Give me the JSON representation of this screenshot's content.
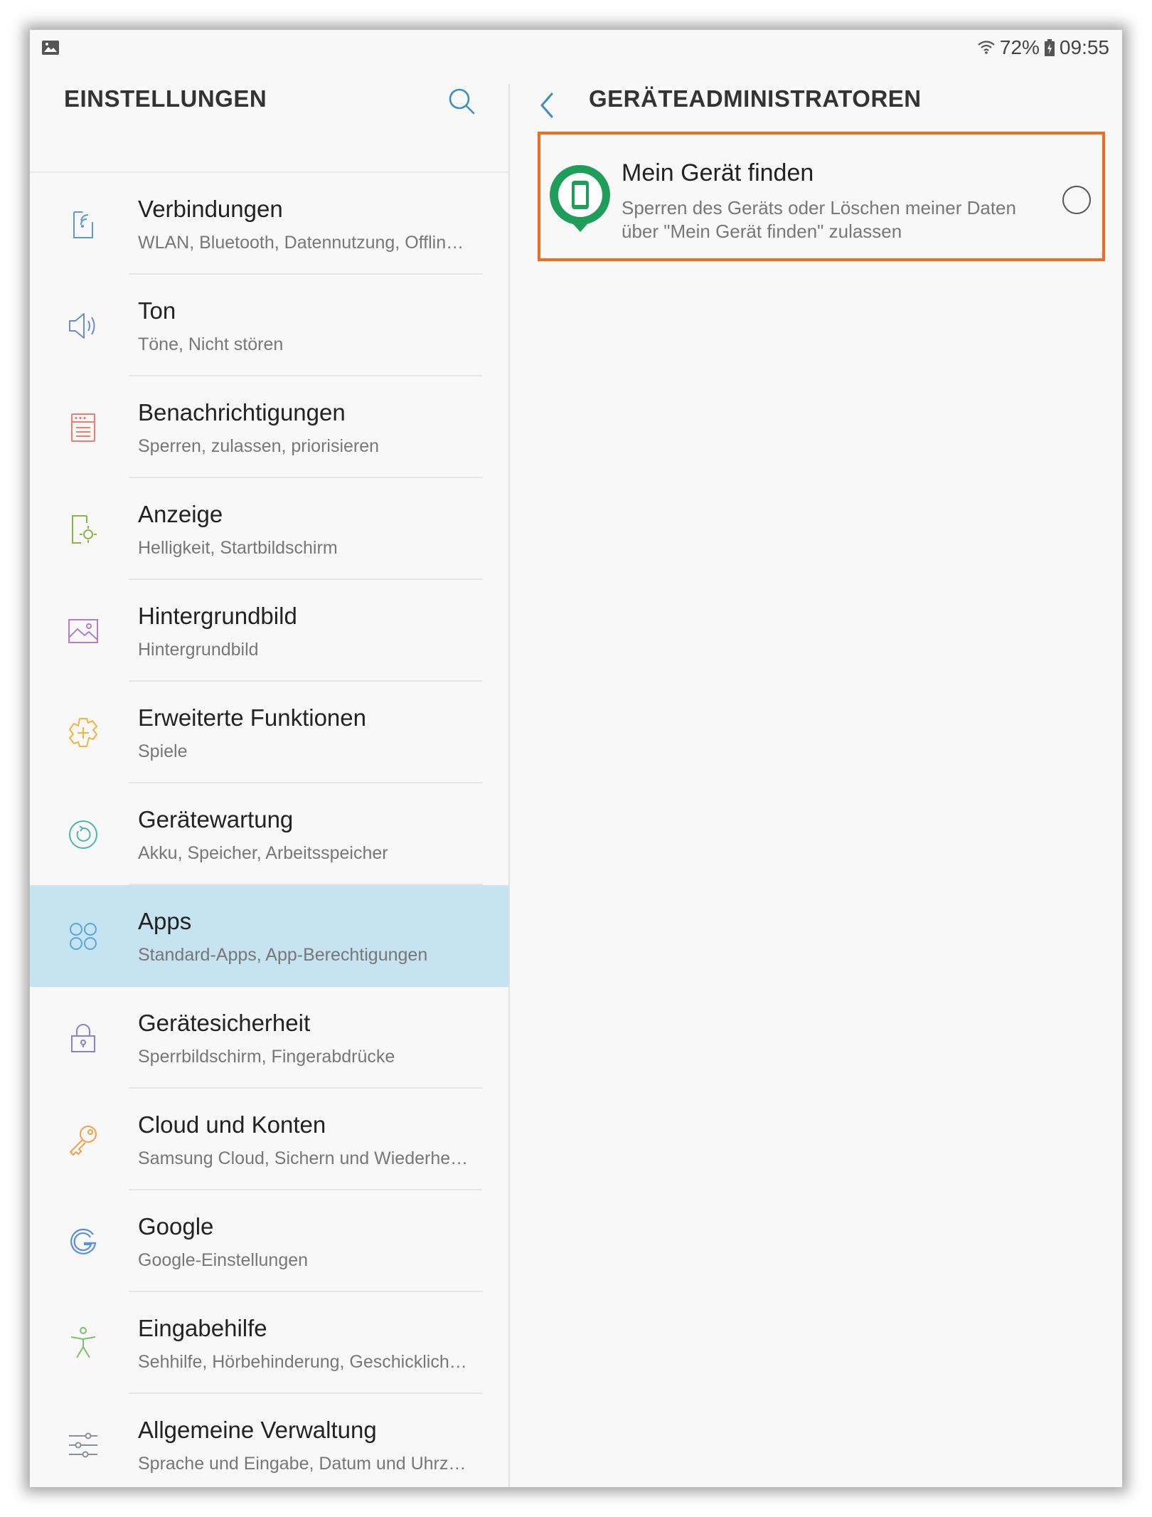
{
  "status_bar": {
    "left_icon": "gallery-icon",
    "battery": "72%",
    "time": "09:55"
  },
  "left_panel": {
    "title": "EINSTELLUNGEN",
    "items": [
      {
        "icon": "connections-icon",
        "title": "Verbindungen",
        "subtitle": "WLAN, Bluetooth, Datennutzung, Offline…",
        "color": "#5a9bd5"
      },
      {
        "icon": "sound-icon",
        "title": "Ton",
        "subtitle": "Töne, Nicht stören",
        "color": "#6b8bd6"
      },
      {
        "icon": "notifications-icon",
        "title": "Benachrichtigungen",
        "subtitle": "Sperren, zulassen, priorisieren",
        "color": "#ef7c6e"
      },
      {
        "icon": "display-icon",
        "title": "Anzeige",
        "subtitle": "Helligkeit, Startbildschirm",
        "color": "#8bb543"
      },
      {
        "icon": "wallpaper-icon",
        "title": "Hintergrundbild",
        "subtitle": "Hintergrundbild",
        "color": "#b37fc9"
      },
      {
        "icon": "advanced-features-icon",
        "title": "Erweiterte Funktionen",
        "subtitle": "Spiele",
        "color": "#f2b340"
      },
      {
        "icon": "device-maintenance-icon",
        "title": "Gerätewartung",
        "subtitle": "Akku, Speicher, Arbeitsspeicher",
        "color": "#4db6a6"
      },
      {
        "icon": "apps-icon",
        "title": "Apps",
        "subtitle": "Standard-Apps, App-Berechtigungen",
        "color": "#5aa7d6",
        "selected": true
      },
      {
        "icon": "lock-icon",
        "title": "Gerätesicherheit",
        "subtitle": "Sperrbildschirm, Fingerabdrücke",
        "color": "#8b7fd6"
      },
      {
        "icon": "key-icon",
        "title": "Cloud und Konten",
        "subtitle": "Samsung Cloud, Sichern und Wiederher…",
        "color": "#f0a04b"
      },
      {
        "icon": "google-icon",
        "title": "Google",
        "subtitle": "Google-Einstellungen",
        "color": "#5b8fe0"
      },
      {
        "icon": "accessibility-icon",
        "title": "Eingabehilfe",
        "subtitle": "Sehhilfe, Hörbehinderung, Geschicklich…",
        "color": "#7fbf6b"
      },
      {
        "icon": "general-management-icon",
        "title": "Allgemeine Verwaltung",
        "subtitle": "Sprache und Eingabe, Datum und Uhrze…",
        "color": "#8a8f99"
      }
    ]
  },
  "right_panel": {
    "title": "GERÄTEADMINISTRATOREN",
    "admin": {
      "icon": "find-my-device-icon",
      "title": "Mein Gerät finden",
      "description": "Sperren des Geräts oder Löschen meiner Daten über \"Mein Gerät finden\" zulassen",
      "enabled": false
    },
    "highlight_color": "#f26c1d",
    "accent": "#1f9d5a"
  }
}
